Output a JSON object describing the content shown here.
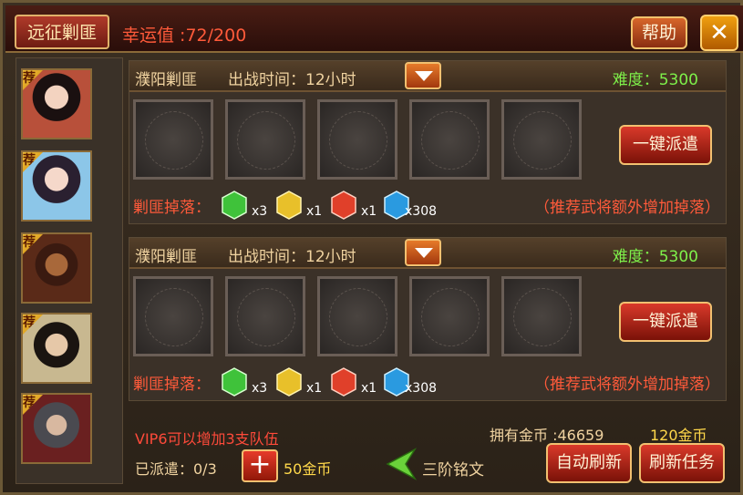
{
  "header": {
    "title": "远征剿匪",
    "luck_label": "幸运值 :72/200",
    "help_label": "帮助",
    "close_symbol": "✕"
  },
  "portraits": [
    {
      "badge": "荐",
      "color": "#a84a3a"
    },
    {
      "badge": "荐",
      "color": "#6fa6c8"
    },
    {
      "badge": "荐",
      "color": "#6a3a22"
    },
    {
      "badge": "荐",
      "color": "#4a5a3a"
    },
    {
      "badge": "荐",
      "color": "#5a3a3a"
    }
  ],
  "missions": [
    {
      "name": "濮阳剿匪",
      "time": "出战时间：12小时",
      "difficulty": "难度：5300",
      "dispatch_label": "一键派遣",
      "drop_label": "剿匪掉落：",
      "drops": [
        {
          "icon": "green-inscription-icon",
          "color": "#3fc23a",
          "qty": "x3"
        },
        {
          "icon": "yellow-inscription-icon",
          "color": "#e8c02a",
          "qty": "x1"
        },
        {
          "icon": "red-inscription-icon",
          "color": "#e0402a",
          "qty": "x1"
        },
        {
          "icon": "blue-exp-inscription-icon",
          "color": "#2a9ae0",
          "qty": "x308"
        }
      ],
      "hint": "（推荐武将额外增加掉落）"
    },
    {
      "name": "濮阳剿匪",
      "time": "出战时间：12小时",
      "difficulty": "难度：5300",
      "dispatch_label": "一键派遣",
      "drop_label": "剿匪掉落：",
      "drops": [
        {
          "icon": "green-inscription-icon",
          "color": "#3fc23a",
          "qty": "x3"
        },
        {
          "icon": "yellow-inscription-icon",
          "color": "#e8c02a",
          "qty": "x1"
        },
        {
          "icon": "red-inscription-icon",
          "color": "#e0402a",
          "qty": "x1"
        },
        {
          "icon": "blue-exp-inscription-icon",
          "color": "#2a9ae0",
          "qty": "x308"
        }
      ],
      "hint": "（推荐武将额外增加掉落）"
    }
  ],
  "footer": {
    "vip_note": "VIP6可以增加3支队伍",
    "dispatched": "已派遣：0/3",
    "add_cost": "50金币",
    "tier_label": "三阶铭文",
    "gold_owned": "拥有金币 :46659",
    "refresh_cost": "120金币",
    "auto_refresh_label": "自动刷新",
    "refresh_task_label": "刷新任务"
  }
}
